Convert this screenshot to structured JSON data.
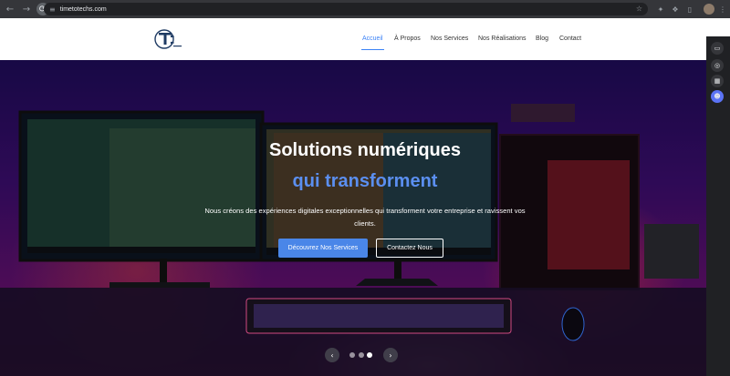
{
  "browser": {
    "url": "timetotechs.com",
    "nav": {
      "back": "←",
      "forward": "→",
      "reload": "⟳"
    },
    "icons": [
      "tune-icon",
      "star-icon",
      "extension-icon",
      "puzzle-icon",
      "sidepanel-icon",
      "profile-avatar",
      "more-icon"
    ]
  },
  "header": {
    "logo_alt": "TimeToTechs",
    "menu": [
      {
        "label": "Accueil",
        "active": true
      },
      {
        "label": "À Propos",
        "active": false
      },
      {
        "label": "Nos Services",
        "active": false
      },
      {
        "label": "Nos Réalisations",
        "active": false
      },
      {
        "label": "Blog",
        "active": false
      },
      {
        "label": "Contact",
        "active": false
      }
    ]
  },
  "hero": {
    "title_line1": "Solutions numériques",
    "title_line2": "qui transforment",
    "subtitle": "Nous créons des expériences digitales exceptionnelles qui transforment votre entreprise et ravissent vos clients.",
    "primary_button": "Découvrez Nos Services",
    "secondary_button": "Contactez Nous",
    "carousel": {
      "prev": "‹",
      "next": "›",
      "slides": 3,
      "active_slide": 3
    }
  },
  "colors": {
    "accent": "#4a86e8",
    "title_accent": "#5b8ff0",
    "header_bg": "#ffffff"
  }
}
